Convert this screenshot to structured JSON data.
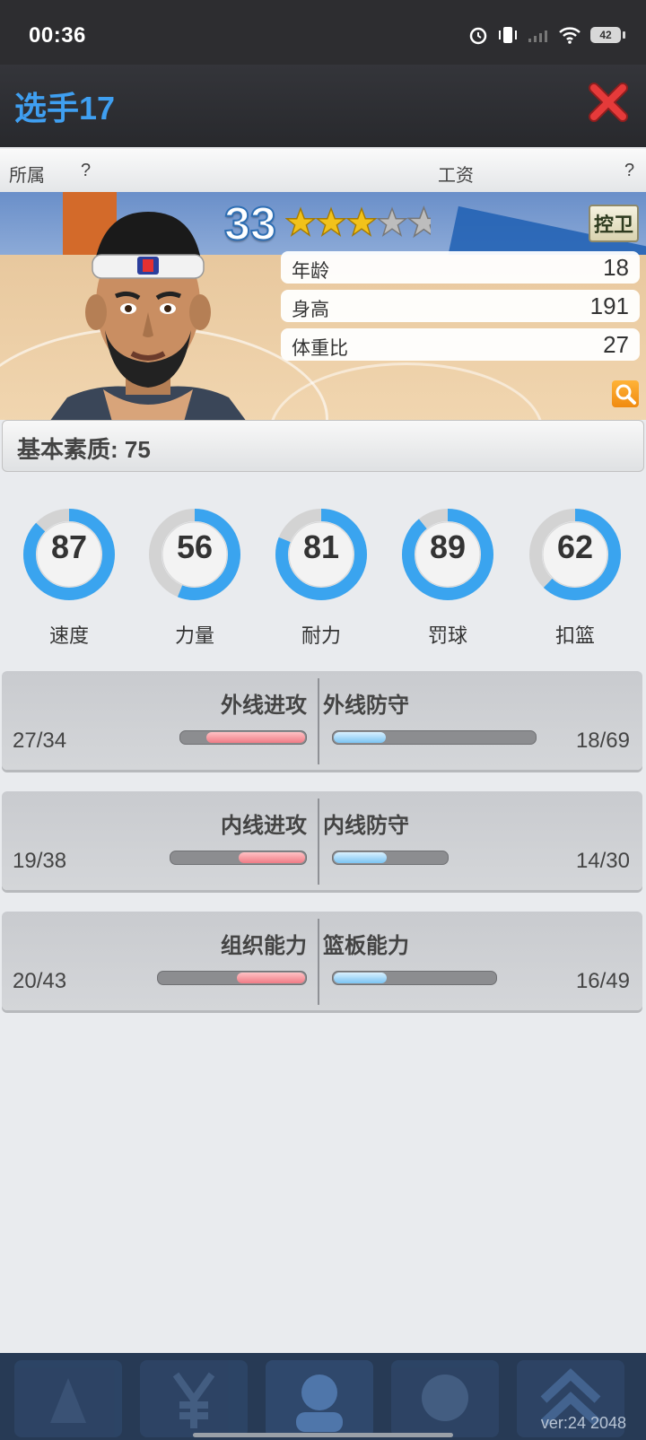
{
  "status": {
    "time": "00:36",
    "battery": "42"
  },
  "header": {
    "title": "选手17"
  },
  "info": {
    "team_label": "所属",
    "team_value": "?",
    "salary_label": "工资",
    "salary_value": "?"
  },
  "player": {
    "level": "33",
    "stars_full": 3,
    "stars_total": 5,
    "position": "控卫",
    "attributes": [
      {
        "label": "年龄",
        "value": "18"
      },
      {
        "label": "身高",
        "value": "191"
      },
      {
        "label": "体重比",
        "value": "27"
      }
    ]
  },
  "basic": {
    "label": "基本素质: 75"
  },
  "skills": [
    {
      "label": "速度",
      "value": 87
    },
    {
      "label": "力量",
      "value": 56
    },
    {
      "label": "耐力",
      "value": 81
    },
    {
      "label": "罚球",
      "value": 89
    },
    {
      "label": "扣篮",
      "value": 62
    }
  ],
  "stat_cards": [
    {
      "left_name": "外线进攻",
      "left_value": "27/34",
      "left_fraction": 0.794,
      "right_name": "外线防守",
      "right_value": "18/69",
      "right_fraction": 0.261
    },
    {
      "left_name": "内线进攻",
      "left_value": "19/38",
      "left_fraction": 0.5,
      "right_name": "内线防守",
      "right_value": "14/30",
      "right_fraction": 0.467
    },
    {
      "left_name": "组织能力",
      "left_value": "20/43",
      "left_fraction": 0.465,
      "right_name": "篮板能力",
      "right_value": "16/49",
      "right_fraction": 0.327
    }
  ],
  "footer": {
    "version": "ver:24  2048"
  },
  "colors": {
    "accent_blue": "#3f9ff1",
    "ring_blue": "#3aa4ef",
    "ring_gray": "#d3d3d3",
    "bar_red": "#f07c86",
    "bar_blue": "#7cc4f3"
  }
}
